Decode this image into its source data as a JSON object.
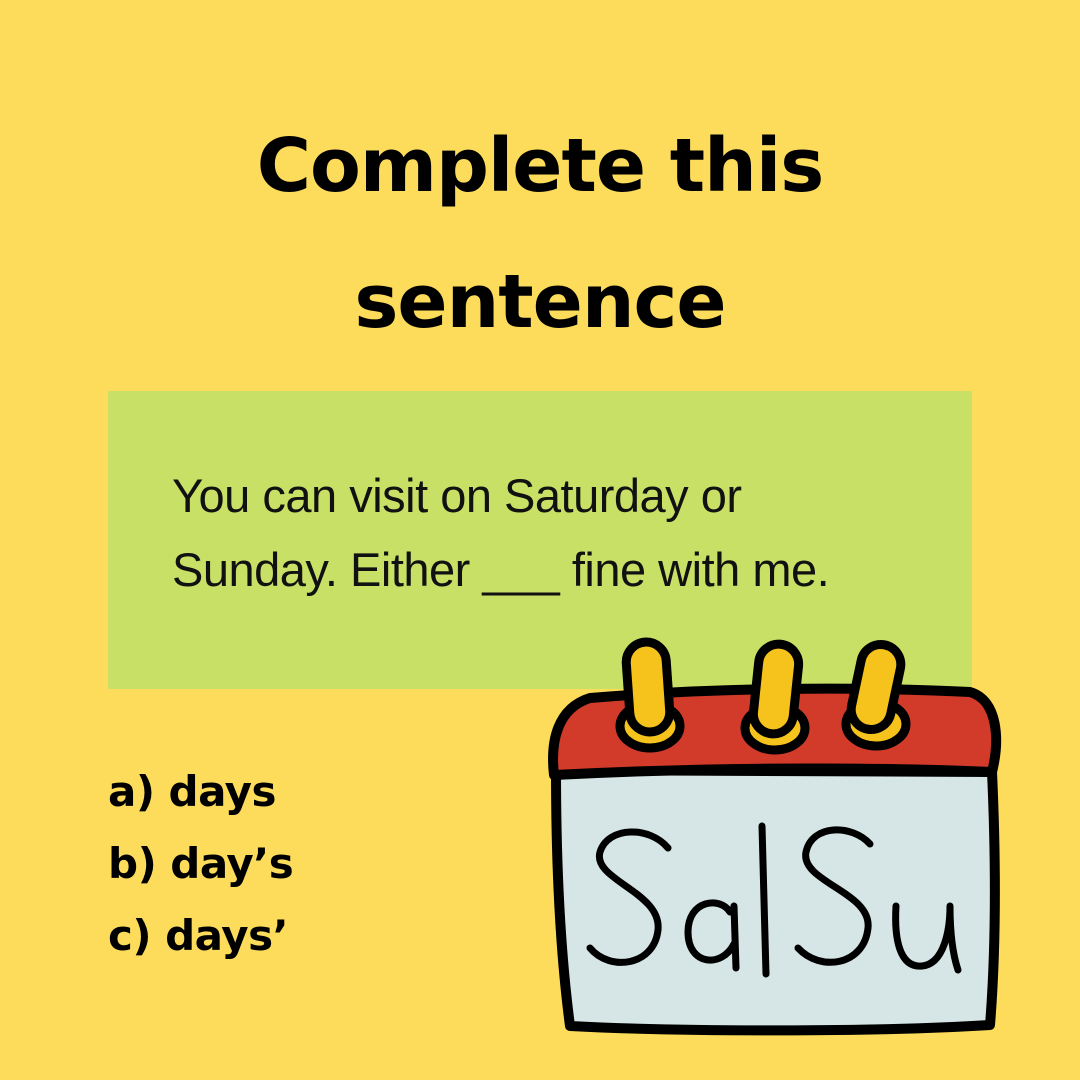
{
  "title": {
    "line1": "Complete this",
    "line2": "sentence"
  },
  "sentence": {
    "line1": "You can visit on Saturday or",
    "line2": "Sunday. Either ___ fine with me."
  },
  "options": [
    {
      "letter": "a)",
      "text": "days"
    },
    {
      "letter": "b)",
      "text": "day’s"
    },
    {
      "letter": "c)",
      "text": "days’"
    }
  ],
  "calendar": {
    "label": "Sa|Su",
    "icon": "calendar-icon"
  },
  "colors": {
    "background": "#fcdc5a",
    "sentence_box": "#c8e065",
    "calendar_header": "#d23a2a",
    "calendar_body": "#d6e5e6",
    "calendar_rings": "#f6c21c"
  }
}
